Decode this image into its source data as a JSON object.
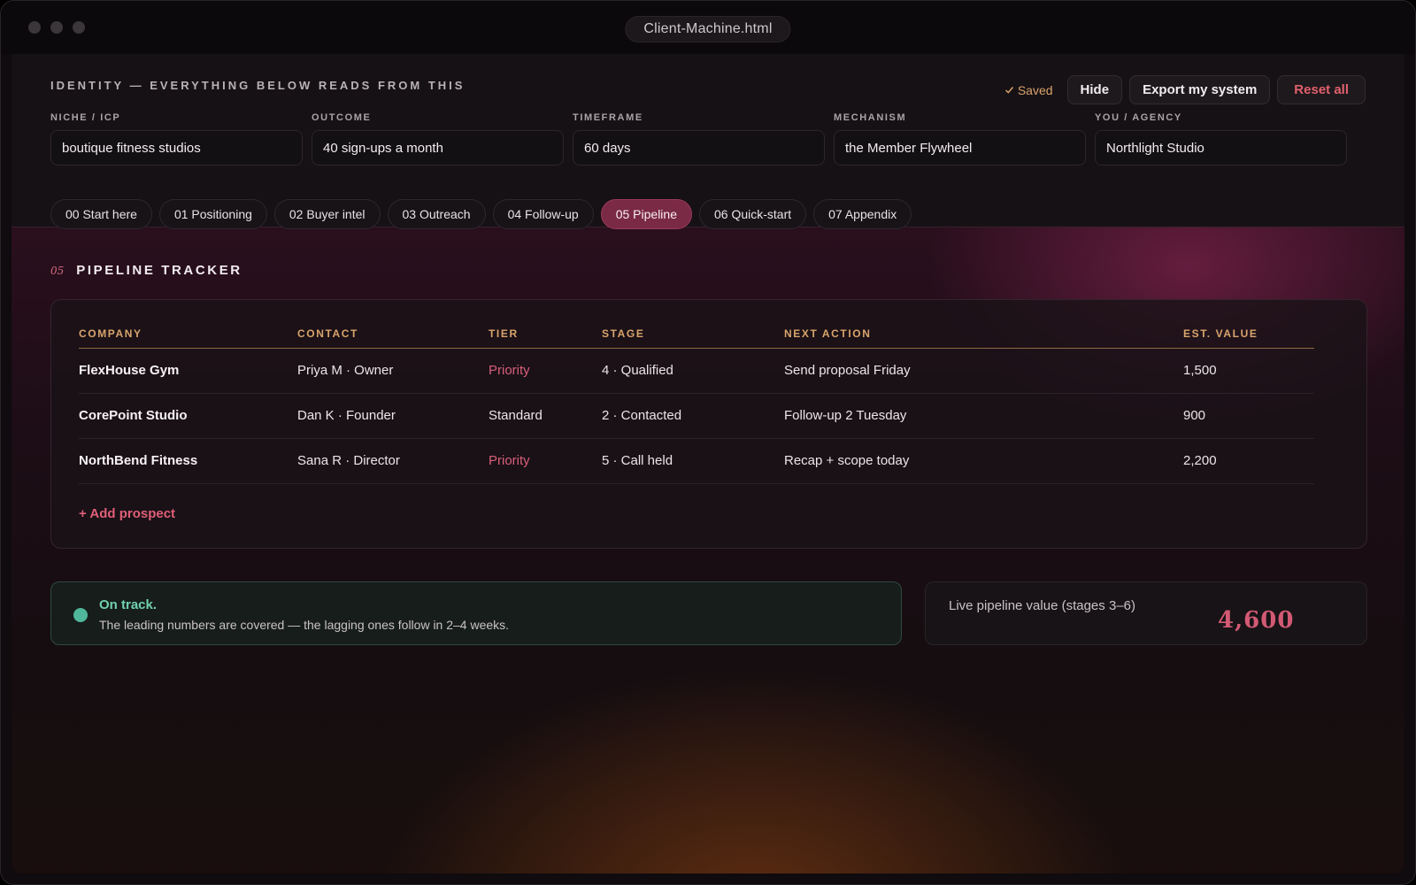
{
  "window": {
    "title": "Client-Machine.html"
  },
  "identity": {
    "title": "IDENTITY — EVERYTHING BELOW READS FROM THIS",
    "saved_label": "Saved",
    "hide_label": "Hide",
    "export_label": "Export my system",
    "reset_label": "Reset all",
    "fields": [
      {
        "label": "NICHE / ICP",
        "value": "boutique fitness studios"
      },
      {
        "label": "OUTCOME",
        "value": "40 sign-ups a month"
      },
      {
        "label": "TIMEFRAME",
        "value": "60 days"
      },
      {
        "label": "MECHANISM",
        "value": "the Member Flywheel"
      },
      {
        "label": "YOU / AGENCY",
        "value": "Northlight Studio"
      }
    ]
  },
  "tabs": [
    {
      "label": "00 Start here",
      "active": false
    },
    {
      "label": "01 Positioning",
      "active": false
    },
    {
      "label": "02 Buyer intel",
      "active": false
    },
    {
      "label": "03 Outreach",
      "active": false
    },
    {
      "label": "04 Follow-up",
      "active": false
    },
    {
      "label": "05 Pipeline",
      "active": true
    },
    {
      "label": "06 Quick-start",
      "active": false
    },
    {
      "label": "07 Appendix",
      "active": false
    }
  ],
  "section": {
    "number": "05",
    "title": "PIPELINE TRACKER"
  },
  "pipeline": {
    "columns": [
      "COMPANY",
      "CONTACT",
      "TIER",
      "STAGE",
      "NEXT ACTION",
      "EST. VALUE"
    ],
    "rows": [
      {
        "company": "FlexHouse Gym",
        "contact": "Priya M · Owner",
        "tier": "Priority",
        "stage": "4 · Qualified",
        "next_action": "Send proposal Friday",
        "value": "1,500"
      },
      {
        "company": "CorePoint Studio",
        "contact": "Dan K · Founder",
        "tier": "Standard",
        "stage": "2 · Contacted",
        "next_action": "Follow-up 2 Tuesday",
        "value": "900"
      },
      {
        "company": "NorthBend Fitness",
        "contact": "Sana R · Director",
        "tier": "Priority",
        "stage": "5 · Call held",
        "next_action": "Recap + scope today",
        "value": "2,200"
      }
    ],
    "add_label": "+ Add prospect"
  },
  "status": {
    "title": "On track.",
    "text": "The leading numbers are covered — the lagging ones follow in 2–4 weeks."
  },
  "summary": {
    "label": "Live pipeline value (stages 3–6)",
    "value": "4,600"
  },
  "colors": {
    "accent": "#7a2a45",
    "priority": "#d85f7a",
    "header_gold": "#d9a46c",
    "success": "#4fb79a"
  }
}
